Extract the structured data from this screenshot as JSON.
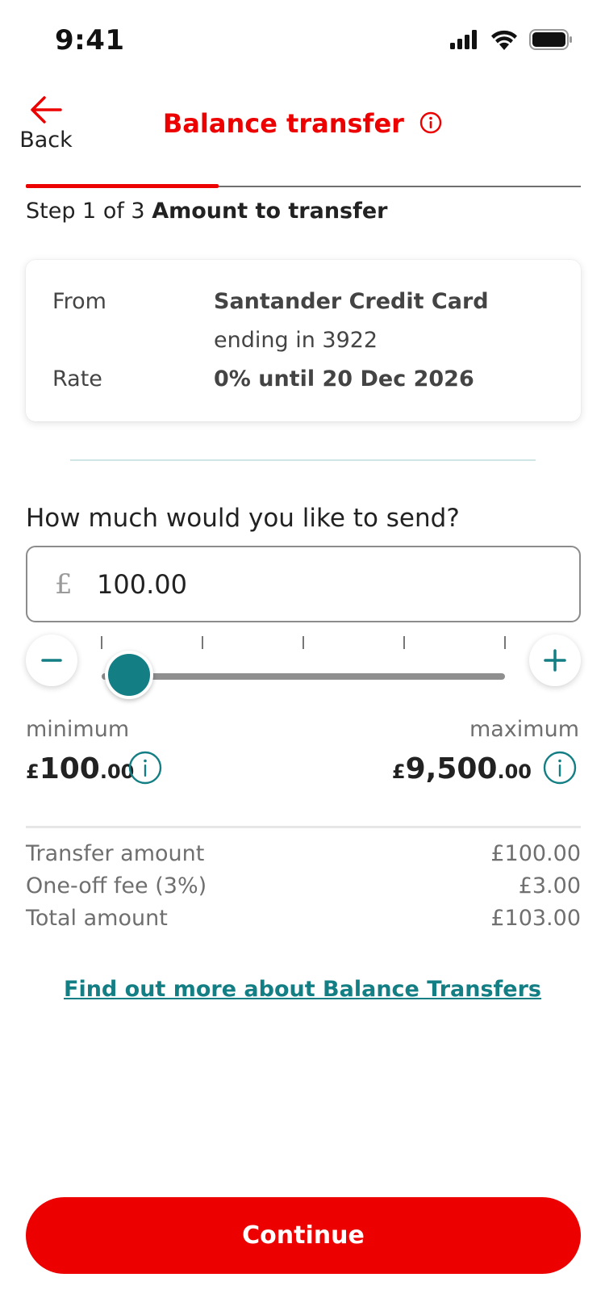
{
  "status_bar": {
    "time": "9:41"
  },
  "header": {
    "back_label": "Back",
    "title": "Balance transfer"
  },
  "progress": {
    "fraction": 0.333,
    "step_prefix": "Step 1 of 3",
    "step_title": "Amount to transfer"
  },
  "card": {
    "from_label": "From",
    "from_value": "Santander Credit Card",
    "from_sub": "ending in 3922",
    "rate_label": "Rate",
    "rate_value": "0% until 20 Dec 2026"
  },
  "amount": {
    "question": "How much would you like to send?",
    "currency": "£",
    "value": "100.00"
  },
  "slider": {
    "min": 100,
    "max": 9500,
    "value": 100,
    "tick_count": 5
  },
  "range": {
    "min_label": "minimum",
    "min_currency": "£",
    "min_whole": "100",
    "min_decimal": ".00",
    "max_label": "maximum",
    "max_currency": "£",
    "max_whole": "9,500",
    "max_decimal": ".00"
  },
  "summary": {
    "rows": [
      {
        "label": "Transfer amount",
        "value": "£100.00"
      },
      {
        "label": "One-off fee (3%)",
        "value": "£3.00"
      },
      {
        "label": "Total amount",
        "value": "£103.00"
      }
    ]
  },
  "link": {
    "label": "Find out more about Balance Transfers"
  },
  "footer": {
    "continue_label": "Continue"
  },
  "colors": {
    "brand_red": "#ec0000",
    "accent_teal": "#137e84"
  },
  "icons": {
    "back": "arrow-left-icon",
    "title_info": "info-icon",
    "minus": "minus-icon",
    "plus": "plus-icon",
    "range_info": "info-icon"
  }
}
